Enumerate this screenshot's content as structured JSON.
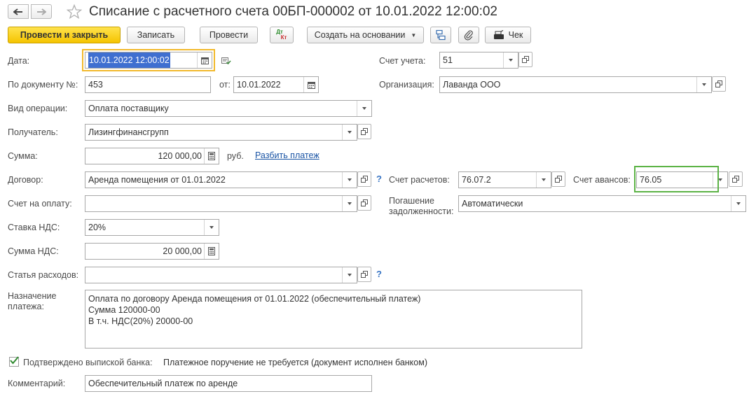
{
  "header": {
    "title": "Списание с расчетного счета 00БП-000002 от 10.01.2022 12:00:02"
  },
  "toolbar": {
    "post_close": "Провести и закрыть",
    "save": "Записать",
    "post": "Провести",
    "dt_kt_top": "Дт",
    "dt_kt_bottom": "Кт",
    "create_based": "Создать на основании",
    "receipt": "Чек"
  },
  "form": {
    "date_label": "Дата:",
    "date_value": "10.01.2022 12:00:02",
    "doc_no_label": "По документу №:",
    "doc_no_value": "453",
    "from_label": "от:",
    "from_value": "10.01.2022",
    "op_type_label": "Вид операции:",
    "op_type_value": "Оплата поставщику",
    "recipient_label": "Получатель:",
    "recipient_value": "Лизингфинансгрупп",
    "amount_label": "Сумма:",
    "amount_value": "120 000,00",
    "currency": "руб.",
    "split_link": "Разбить платеж",
    "contract_label": "Договор:",
    "contract_value": "Аренда помещения от 01.01.2022",
    "invoice_label": "Счет на оплату:",
    "invoice_value": "",
    "vat_rate_label": "Ставка НДС:",
    "vat_rate_value": "20%",
    "vat_amount_label": "Сумма НДС:",
    "vat_amount_value": "20 000,00",
    "expense_label": "Статья расходов:",
    "expense_value": "",
    "purpose_label_1": "Назначение",
    "purpose_label_2": "платежа:",
    "purpose_lines": [
      "Оплата по договору Аренда помещения от 01.01.2022 (обеспечительный платеж)",
      "Сумма 120000-00",
      "В т.ч. НДС(20%) 20000-00"
    ],
    "confirmed_label": "Подтверждено выпиской банка:",
    "confirmed_checked": true,
    "payment_order_note": "Платежное поручение не требуется (документ исполнен банком)",
    "comment_label": "Комментарий:",
    "comment_value": "Обеспечительный платеж по аренде",
    "account_label": "Счет учета:",
    "account_value": "51",
    "org_label": "Организация:",
    "org_value": "Лаванда ООО",
    "settle_account_label": "Счет расчетов:",
    "settle_account_value": "76.07.2",
    "advance_account_label": "Счет авансов:",
    "advance_account_value": "76.05",
    "repayment_label_1": "Погашение",
    "repayment_label_2": "задолженности:",
    "repayment_value": "Автоматически",
    "help_mark": "?"
  },
  "colors": {
    "primary_button": "#f5c400",
    "focus_outline": "#f2b92c",
    "highlight_green": "#5cb346",
    "link": "#1b55a5",
    "selection": "#3f6fd0"
  }
}
